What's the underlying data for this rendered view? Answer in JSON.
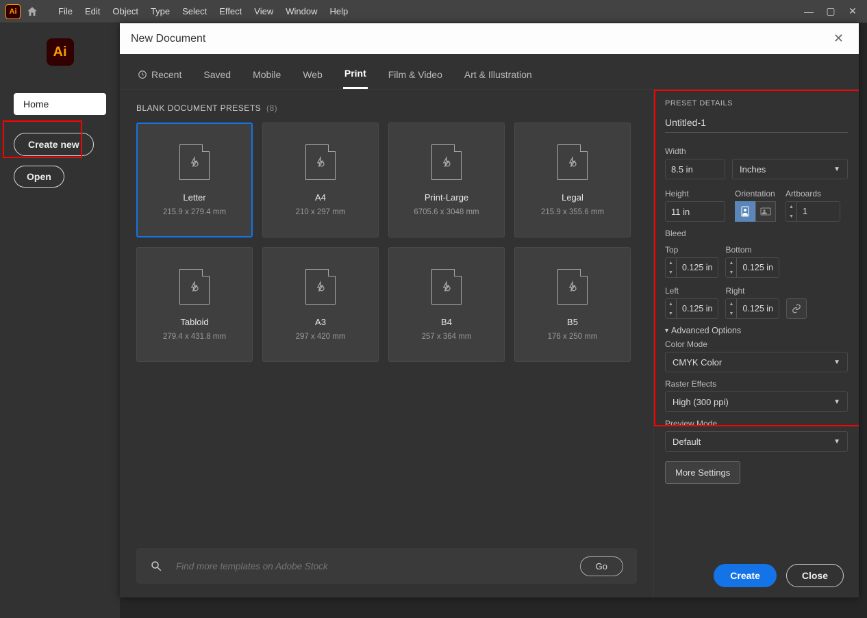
{
  "menubar": {
    "items": [
      "File",
      "Edit",
      "Object",
      "Type",
      "Select",
      "Effect",
      "View",
      "Window",
      "Help"
    ]
  },
  "home": {
    "home_label": "Home",
    "create_label": "Create new",
    "open_label": "Open"
  },
  "dialog": {
    "title": "New Document",
    "tabs": [
      "Recent",
      "Saved",
      "Mobile",
      "Web",
      "Print",
      "Film & Video",
      "Art & Illustration"
    ],
    "active_tab": "Print",
    "presets_heading": "BLANK DOCUMENT PRESETS",
    "presets_count": "(8)",
    "presets": [
      {
        "name": "Letter",
        "dim": "215.9 x 279.4 mm",
        "selected": true
      },
      {
        "name": "A4",
        "dim": "210 x 297 mm"
      },
      {
        "name": "Print-Large",
        "dim": "6705.6 x 3048 mm"
      },
      {
        "name": "Legal",
        "dim": "215.9 x 355.6 mm"
      },
      {
        "name": "Tabloid",
        "dim": "279.4 x 431.8 mm"
      },
      {
        "name": "A3",
        "dim": "297 x 420 mm"
      },
      {
        "name": "B4",
        "dim": "257 x 364 mm"
      },
      {
        "name": "B5",
        "dim": "176 x 250 mm"
      }
    ],
    "search_placeholder": "Find more templates on Adobe Stock",
    "go_label": "Go",
    "create_label": "Create",
    "close_label": "Close"
  },
  "details": {
    "heading": "PRESET DETAILS",
    "name": "Untitled-1",
    "width_label": "Width",
    "width": "8.5 in",
    "units": "Inches",
    "height_label": "Height",
    "height": "11 in",
    "orientation_label": "Orientation",
    "artboards_label": "Artboards",
    "artboards": "1",
    "bleed_label": "Bleed",
    "top_label": "Top",
    "top": "0.125 in",
    "bottom_label": "Bottom",
    "bottom": "0.125 in",
    "left_label": "Left",
    "left": "0.125 in",
    "right_label": "Right",
    "right": "0.125 in",
    "adv_label": "Advanced Options",
    "color_mode_label": "Color Mode",
    "color_mode": "CMYK Color",
    "raster_label": "Raster Effects",
    "raster": "High (300 ppi)",
    "preview_label": "Preview Mode",
    "preview": "Default",
    "more_label": "More Settings"
  }
}
